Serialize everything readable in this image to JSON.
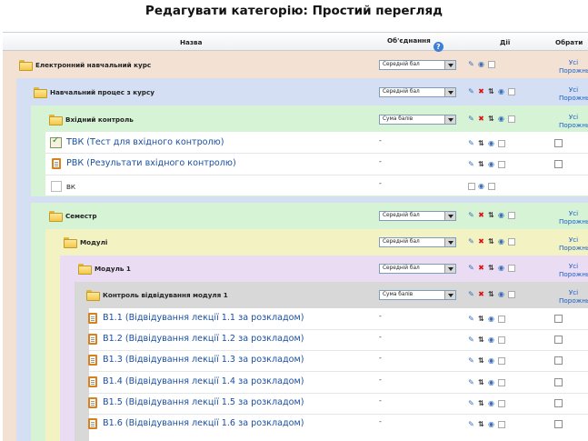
{
  "page": {
    "title": "Редагувати категорію: Простий перегляд"
  },
  "table": {
    "headers": {
      "name": "Назва",
      "aggregation": "Об'єднання",
      "actions": "Дії",
      "select": "Обрати"
    },
    "select_links": {
      "all": "Усі",
      "none": "Порожньо"
    },
    "colors": {
      "level0": "#f3e2d4",
      "level1": "#d4dff3",
      "level2": "#d6f3d6",
      "level3": "#f2f2c2",
      "level4": "#eadcf3",
      "level5": "#d8d8d8"
    },
    "categories": [
      {
        "name": "Електронний навчальний курс",
        "aggregation": "Середній бал"
      },
      {
        "name": "Навчальний процес з курсу",
        "aggregation": "Середній бал"
      },
      {
        "name": "Вхідний контроль",
        "aggregation": "Сума балів"
      },
      {
        "name": "Семестр",
        "aggregation": "Середній бал"
      },
      {
        "name": "Модулі",
        "aggregation": "Середній бал"
      },
      {
        "name": "Модуль 1",
        "aggregation": "Середній бал"
      },
      {
        "name": "Контроль відвідування модуля 1",
        "aggregation": "Сума балів"
      }
    ],
    "items": [
      {
        "name": "ТВК (Тест для вхідного контролю)",
        "value": "-"
      },
      {
        "name": "РВК (Результати вхідного контролю)",
        "value": "-"
      },
      {
        "name": "ВК",
        "value": "-"
      },
      {
        "name": "В1.1 (Відвідування лекції 1.1 за розкладом)",
        "value": "-"
      },
      {
        "name": "В1.2 (Відвідування лекції 1.2 за розкладом)",
        "value": "-"
      },
      {
        "name": "В1.3 (Відвідування лекції 1.3 за розкладом)",
        "value": "-"
      },
      {
        "name": "В1.4 (Відвідування лекції 1.4 за розкладом)",
        "value": "-"
      },
      {
        "name": "В1.5 (Відвідування лекції 1.5 за розкладом)",
        "value": "-"
      },
      {
        "name": "В1.6 (Відвідування лекції 1.6 за розкладом)",
        "value": "-"
      }
    ]
  }
}
